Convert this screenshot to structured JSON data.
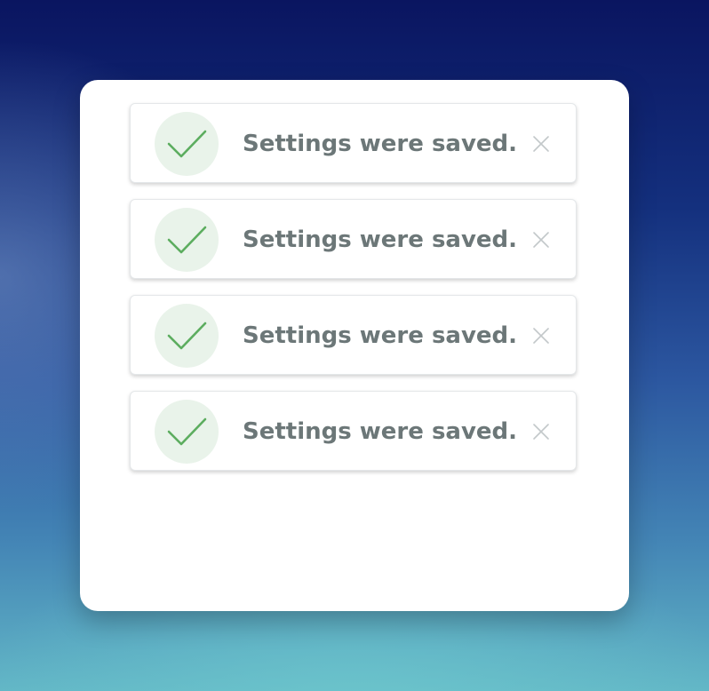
{
  "colors": {
    "check": "#5cad5f",
    "check_bg": "#e9f3ea",
    "message_text": "#6c7778",
    "close_icon": "#c3c8ca"
  },
  "toasts": [
    {
      "status_icon": "check-icon",
      "message": "Settings were saved.",
      "close_icon": "close-icon"
    },
    {
      "status_icon": "check-icon",
      "message": "Settings were saved.",
      "close_icon": "close-icon"
    },
    {
      "status_icon": "check-icon",
      "message": "Settings were saved.",
      "close_icon": "close-icon"
    },
    {
      "status_icon": "check-icon",
      "message": "Settings were saved.",
      "close_icon": "close-icon"
    }
  ]
}
